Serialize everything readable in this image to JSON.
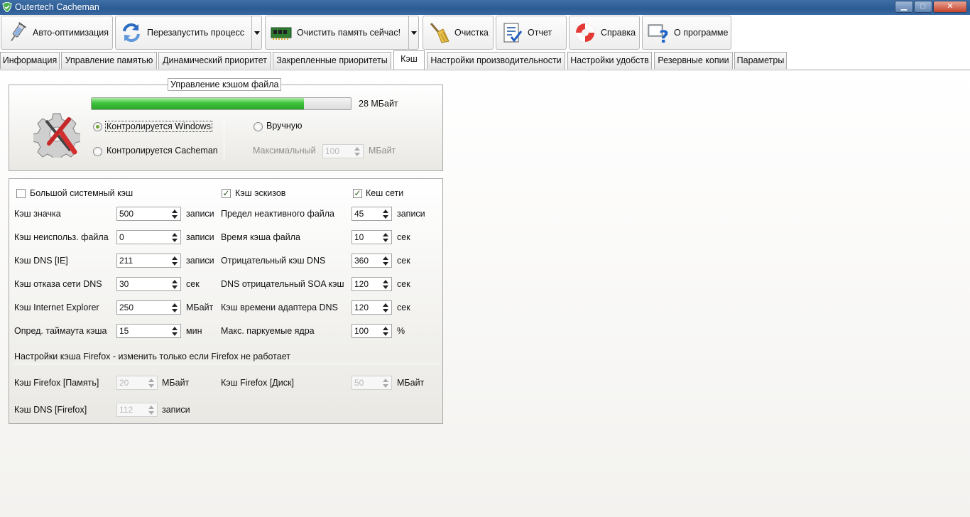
{
  "window": {
    "title": "Outertech Cacheman",
    "min": "▁",
    "max": "□",
    "close": "✕"
  },
  "toolbar": {
    "auto_opt": "Авто-оптимизация",
    "restart": "Перезапустить процесс",
    "clear_mem": "Очистить память сейчас!",
    "cleanup": "Очистка",
    "report": "Отчет",
    "help": "Справка",
    "about": "О программе"
  },
  "tabs": [
    "Информация",
    "Управление памятью",
    "Динамический приоритет",
    "Закрепленные приоритеты",
    "Кэш",
    "Настройки производительности",
    "Настройки удобств",
    "Резервные копии",
    "Параметры"
  ],
  "file_cache": {
    "legend": "Управление кэшом файла",
    "usage_label": "28 МБайт",
    "usage_fraction": 0.82,
    "radio_windows": "Контролируется Windows",
    "radio_cacheman": "Контролируется Cacheman",
    "radio_manual": "Вручную",
    "max_label": "Максимальный",
    "max_value": "100",
    "max_unit": "МБайт",
    "selected": "windows"
  },
  "cache": {
    "large_system_cache": {
      "label": "Большой системный кэш",
      "checked": false
    },
    "thumb_cache": {
      "label": "Кэш эскизов",
      "checked": true
    },
    "net_cache": {
      "label": "Кеш сети",
      "checked": true
    },
    "left": [
      {
        "label": "Кэш значка",
        "value": "500",
        "unit": "записи"
      },
      {
        "label": "Кэш неиспольз. файла",
        "value": "0",
        "unit": "записи"
      },
      {
        "label": "Кэш DNS [IE]",
        "value": "211",
        "unit": "записи"
      },
      {
        "label": "Кэш отказа сети DNS",
        "value": "30",
        "unit": "сек"
      },
      {
        "label": "Кэш Internet Explorer",
        "value": "250",
        "unit": "МБайт"
      },
      {
        "label": "Опред. таймаута кэша",
        "value": "15",
        "unit": "мин"
      }
    ],
    "right": [
      {
        "label": "Предел неактивного файла",
        "value": "45",
        "unit": "записи"
      },
      {
        "label": "Время кэша файла",
        "value": "10",
        "unit": "сек"
      },
      {
        "label": "Отрицательный кэш DNS",
        "value": "360",
        "unit": "сек"
      },
      {
        "label": "DNS отрицательный SOA кэш",
        "value": "120",
        "unit": "сек"
      },
      {
        "label": "Кэш времени адаптера DNS",
        "value": "120",
        "unit": "сек"
      },
      {
        "label": "Макс. паркуемые ядра",
        "value": "100",
        "unit": "%"
      }
    ],
    "firefox_header": "Настройки кэша Firefox - изменить только если Firefox не работает",
    "ff_mem": {
      "label": "Кэш Firefox [Память]",
      "value": "20",
      "unit": "МБайт"
    },
    "ff_disk": {
      "label": "Кэш Firefox [Диск]",
      "value": "50",
      "unit": "МБайт"
    },
    "ff_dns": {
      "label": "Кэш DNS [Firefox]",
      "value": "112",
      "unit": "записи"
    }
  }
}
